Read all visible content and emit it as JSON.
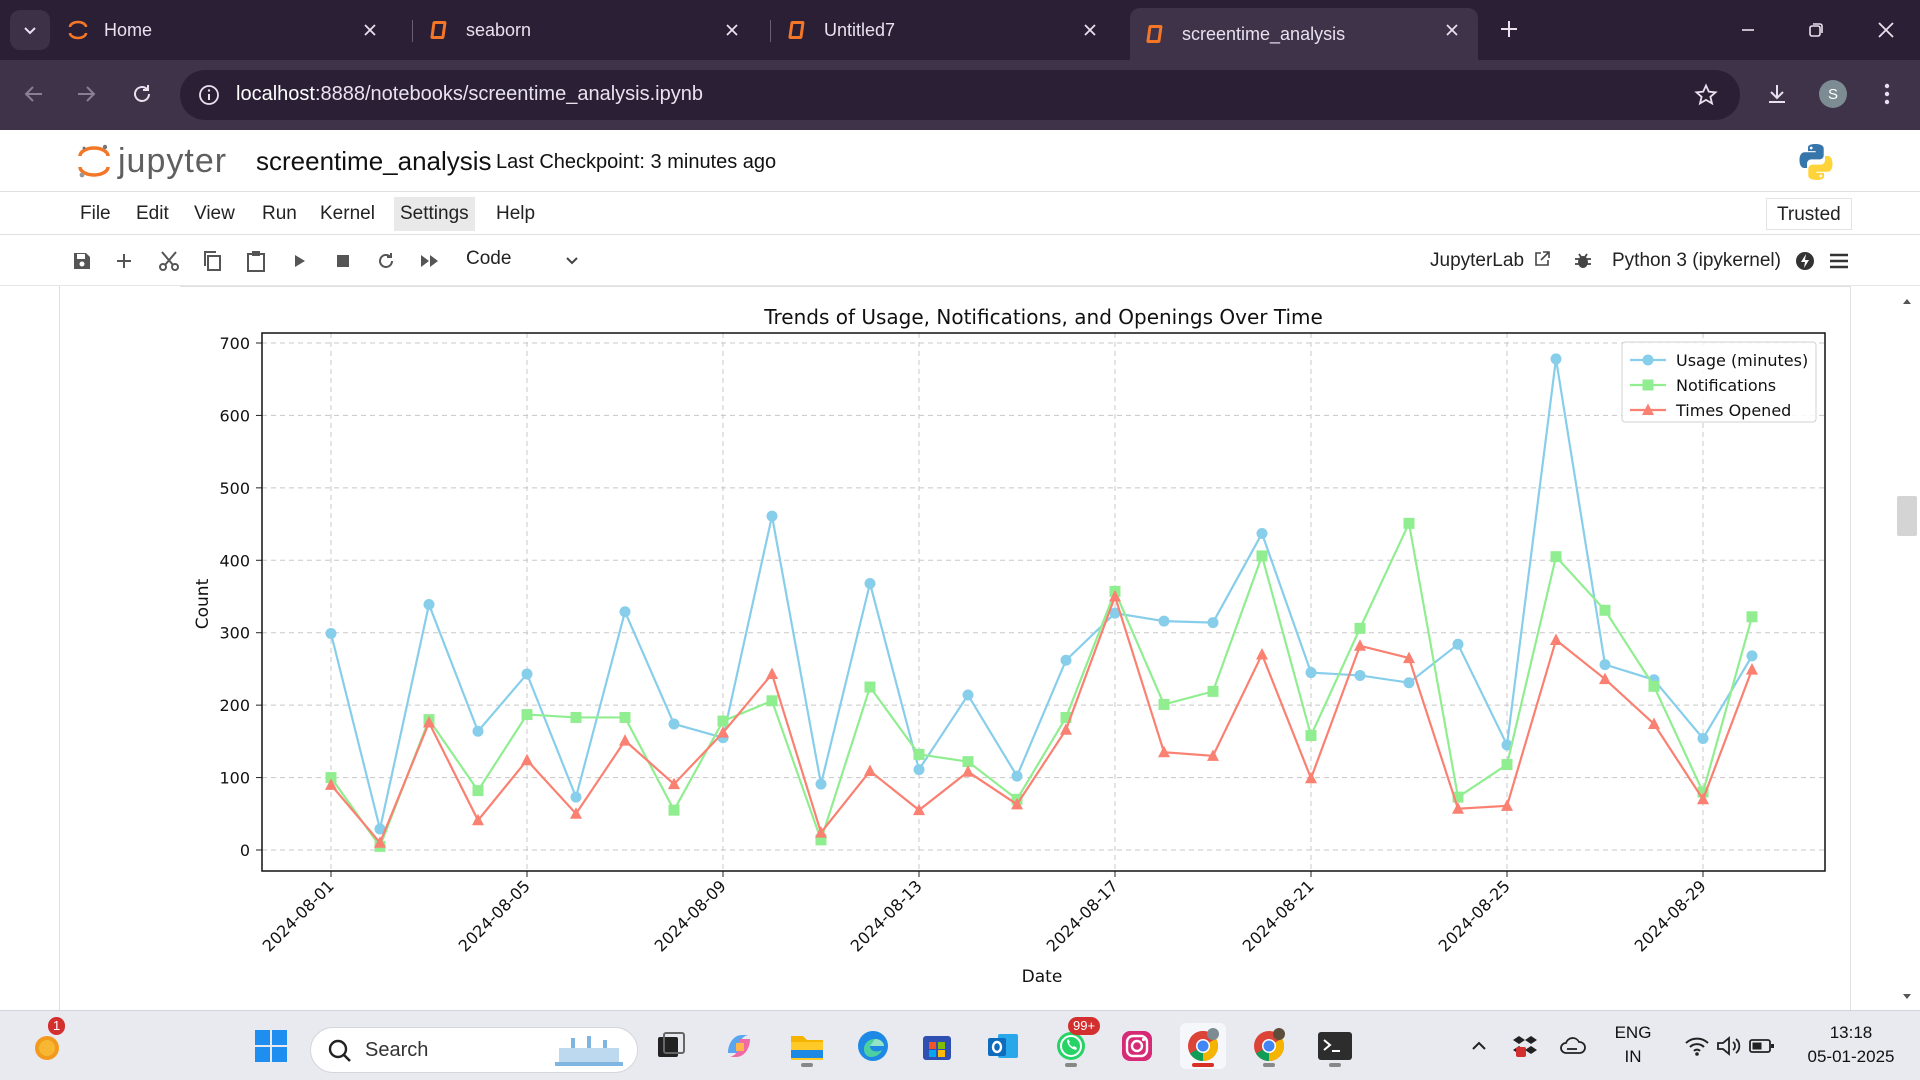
{
  "browser": {
    "tabs": [
      {
        "title": "Home",
        "icon": "jupyter-icon",
        "active": false
      },
      {
        "title": "seaborn",
        "icon": "notebook-icon",
        "active": false
      },
      {
        "title": "Untitled7",
        "icon": "notebook-icon",
        "active": false
      },
      {
        "title": "screentime_analysis",
        "icon": "notebook-icon",
        "active": true
      }
    ],
    "url_host": "localhost",
    "url_path": ":8888/notebooks/screentime_analysis.ipynb",
    "profile_initial": "S"
  },
  "jupyter": {
    "logo_text": "jupyter",
    "notebook_name": "screentime_analysis",
    "checkpoint": "Last Checkpoint: 3 minutes ago",
    "menu": [
      "File",
      "Edit",
      "View",
      "Run",
      "Kernel",
      "Settings",
      "Help"
    ],
    "trusted": "Trusted",
    "cell_type": "Code",
    "jupyterlab_link": "JupyterLab",
    "kernel": "Python 3 (ipykernel)"
  },
  "chart_data": {
    "type": "line",
    "title": "Trends of Usage, Notifications, and Openings Over Time",
    "xlabel": "Date",
    "ylabel": "Count",
    "ylim": [
      -30,
      700
    ],
    "yticks": [
      0,
      100,
      200,
      300,
      400,
      500,
      600,
      700
    ],
    "xticks": [
      "2024-08-01",
      "2024-08-05",
      "2024-08-09",
      "2024-08-13",
      "2024-08-17",
      "2024-08-21",
      "2024-08-25",
      "2024-08-29"
    ],
    "grid": true,
    "legend_position": "top-right",
    "x": [
      "2024-08-01",
      "2024-08-02",
      "2024-08-03",
      "2024-08-04",
      "2024-08-05",
      "2024-08-06",
      "2024-08-07",
      "2024-08-08",
      "2024-08-09",
      "2024-08-10",
      "2024-08-11",
      "2024-08-12",
      "2024-08-13",
      "2024-08-14",
      "2024-08-15",
      "2024-08-16",
      "2024-08-17",
      "2024-08-18",
      "2024-08-19",
      "2024-08-20",
      "2024-08-21",
      "2024-08-22",
      "2024-08-23",
      "2024-08-24",
      "2024-08-25",
      "2024-08-26",
      "2024-08-27",
      "2024-08-28",
      "2024-08-29",
      "2024-08-30"
    ],
    "series": [
      {
        "name": "Usage (minutes)",
        "color": "#87ceeb",
        "marker": "circle",
        "values": [
          299,
          29,
          339,
          164,
          243,
          73,
          329,
          174,
          155,
          461,
          91,
          368,
          111,
          214,
          102,
          262,
          327,
          316,
          314,
          437,
          245,
          241,
          231,
          284,
          145,
          678,
          256,
          235,
          154,
          268
        ]
      },
      {
        "name": "Notifications",
        "color": "#90ee90",
        "marker": "square",
        "values": [
          100,
          5,
          180,
          82,
          187,
          183,
          183,
          55,
          178,
          206,
          14,
          225,
          132,
          122,
          70,
          183,
          357,
          201,
          219,
          406,
          158,
          306,
          451,
          73,
          118,
          405,
          331,
          226,
          80,
          322
        ]
      },
      {
        "name": "Times Opened",
        "color": "#fa8072",
        "marker": "triangle",
        "values": [
          90,
          10,
          176,
          41,
          124,
          50,
          151,
          91,
          162,
          243,
          24,
          109,
          55,
          108,
          63,
          166,
          350,
          135,
          130,
          270,
          99,
          282,
          265,
          57,
          61,
          290,
          236,
          174,
          70,
          249
        ]
      }
    ]
  },
  "taskbar": {
    "search_placeholder": "Search",
    "notification_badge": "1",
    "whatsapp_badge": "99+",
    "lang_top": "ENG",
    "lang_bottom": "IN",
    "time": "13:18",
    "date": "05-01-2025"
  }
}
